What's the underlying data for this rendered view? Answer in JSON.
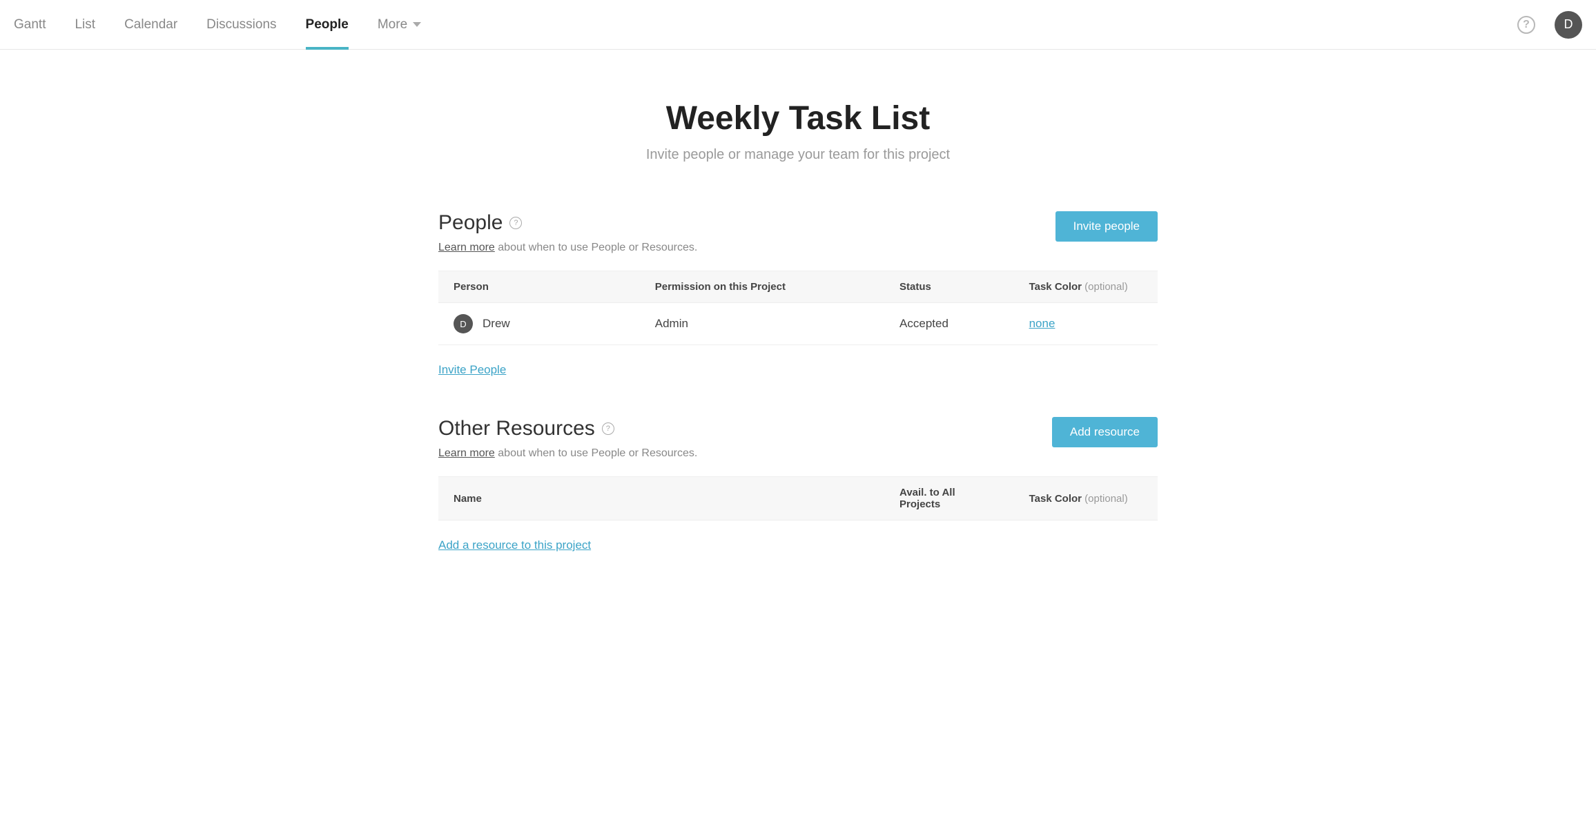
{
  "nav": {
    "tabs": [
      {
        "label": "Gantt"
      },
      {
        "label": "List"
      },
      {
        "label": "Calendar"
      },
      {
        "label": "Discussions"
      },
      {
        "label": "People",
        "active": true
      }
    ],
    "more_label": "More",
    "help_glyph": "?",
    "avatar_initial": "D"
  },
  "header": {
    "title": "Weekly Task List",
    "subtitle": "Invite people or manage your team for this project"
  },
  "people": {
    "heading": "People",
    "learn_more": "Learn more",
    "learn_more_suffix": " about when to use People or Resources.",
    "invite_button": "Invite people",
    "columns": {
      "person": "Person",
      "permission": "Permission on this Project",
      "status": "Status",
      "task_color": "Task Color",
      "task_color_optional": "(optional)"
    },
    "rows": [
      {
        "avatar_initial": "D",
        "name": "Drew",
        "permission": "Admin",
        "status": "Accepted",
        "task_color": "none"
      }
    ],
    "footer_link": "Invite People"
  },
  "resources": {
    "heading": "Other Resources",
    "learn_more": "Learn more",
    "learn_more_suffix": " about when to use People or Resources.",
    "add_button": "Add resource",
    "columns": {
      "name": "Name",
      "avail": "Avail. to All Projects",
      "task_color": "Task Color",
      "task_color_optional": "(optional)"
    },
    "footer_link": "Add a resource to this project"
  }
}
